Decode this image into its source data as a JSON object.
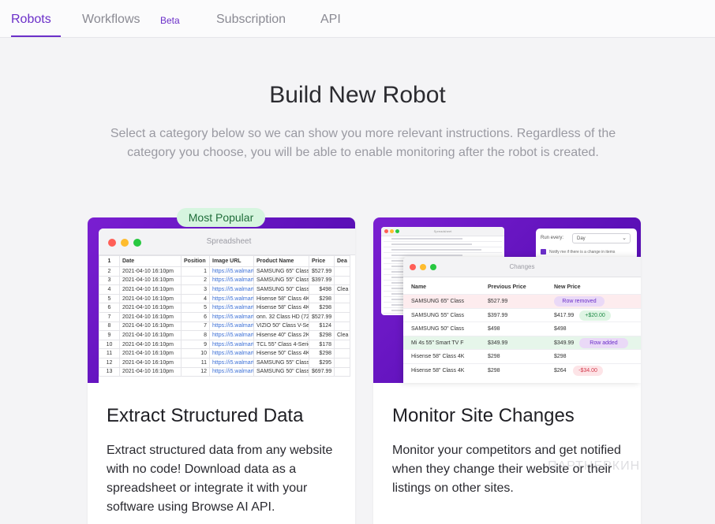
{
  "nav": {
    "tabs": [
      {
        "label": "Robots"
      },
      {
        "label": "Workflows"
      },
      {
        "label": "Subscription"
      },
      {
        "label": "API"
      }
    ],
    "beta_badge": "Beta"
  },
  "header": {
    "title": "Build New Robot",
    "subtitle": "Select a category below so we can show you more relevant instructions. Regardless of the category you choose, you will be able to enable monitoring after the robot is created."
  },
  "badge": "Most Popular",
  "cards": [
    {
      "title": "Extract Structured Data",
      "description": "Extract structured data from any website with no code! Download data as a spreadsheet or integrate it with your software using Browse AI API."
    },
    {
      "title": "Monitor Site Changes",
      "description": "Monitor your competitors and get notified when they change their website or their listings on other sites."
    }
  ],
  "spreadsheet": {
    "window_title": "Spreadsheet",
    "headers": [
      "1",
      "Date",
      "Position",
      "Image URL",
      "Product Name",
      "Price",
      "Dea"
    ],
    "rows": [
      [
        "2",
        "2021-04-10 16:10pm",
        "1",
        "https://i5.walmarti",
        "SAMSUNG 65\" Class",
        "$527.99",
        ""
      ],
      [
        "3",
        "2021-04-10 16:10pm",
        "2",
        "https://i5.walmarti",
        "SAMSUNG 55\" Class",
        "$397.99",
        ""
      ],
      [
        "4",
        "2021-04-10 16:10pm",
        "3",
        "https://i5.walmarti",
        "SAMSUNG 50\" Class",
        "$498",
        "Clea"
      ],
      [
        "5",
        "2021-04-10 16:10pm",
        "4",
        "https://i5.walmarti",
        "Hisense 58\" Class 4K",
        "$298",
        ""
      ],
      [
        "6",
        "2021-04-10 16:10pm",
        "5",
        "https://i5.walmarti",
        "Hisense 58\" Class 4K",
        "$298",
        ""
      ],
      [
        "7",
        "2021-04-10 16:10pm",
        "6",
        "https://i5.walmarti",
        "onn. 32 Class HD (72",
        "$527.99",
        ""
      ],
      [
        "8",
        "2021-04-10 16:10pm",
        "7",
        "https://i5.walmarti",
        "VIZIO 50\" Class V-Ser",
        "$124",
        ""
      ],
      [
        "9",
        "2021-04-10 16:10pm",
        "8",
        "https://i5.walmarti",
        "Hisense 40\" Class 2K",
        "$298",
        "Clea"
      ],
      [
        "10",
        "2021-04-10 16:10pm",
        "9",
        "https://i5.walmarti",
        "TCL 55\" Class 4-Serie",
        "$178",
        ""
      ],
      [
        "11",
        "2021-04-10 16:10pm",
        "10",
        "https://i5.walmarti",
        "Hisense 50\" Class 4K",
        "$298",
        ""
      ],
      [
        "12",
        "2021-04-10 16:10pm",
        "11",
        "https://i5.walmarti",
        "SAMSUNG 55\" Class",
        "$295",
        ""
      ],
      [
        "13",
        "2021-04-10 16:10pm",
        "12",
        "https://i5.walmarti",
        "SAMSUNG 50\" Class",
        "$697.99",
        ""
      ]
    ]
  },
  "monitor": {
    "small_window_title": "Spreadsheet",
    "run_every_label": "Run every:",
    "run_every_value": "Day",
    "notify_label": "Notify me if there is a change in items",
    "window_title": "Changes",
    "headers": [
      "Name",
      "Previous Price",
      "New Price"
    ],
    "rows": [
      {
        "name": "SAMSUNG 65\" Class",
        "prev": "$527.99",
        "new": "",
        "tag": "Row removed",
        "status": "removed"
      },
      {
        "name": "SAMSUNG 55\" Class",
        "prev": "$397.99",
        "new": "$417.99",
        "tag": "+$20.00",
        "status": "up"
      },
      {
        "name": "SAMSUNG 50\" Class",
        "prev": "$498",
        "new": "$498",
        "tag": "",
        "status": "none"
      },
      {
        "name": "Mi 4s 55\" Smart TV F",
        "prev": "$349.99",
        "new": "$349.99",
        "tag": "Row added",
        "status": "added"
      },
      {
        "name": "Hisense 58\" Class 4K",
        "prev": "$298",
        "new": "$298",
        "tag": "",
        "status": "none"
      },
      {
        "name": "Hisense 58\" Class 4K",
        "prev": "$298",
        "new": "$264",
        "tag": "-$34.00",
        "status": "down"
      }
    ]
  },
  "watermark": "ПАРТНЕРКИН",
  "colors": {
    "accent": "#6b2fc9",
    "card_gradient_start": "#7a1fd1",
    "popular_bg": "#d6f5df",
    "removed_bg": "#fdecee",
    "added_bg": "#e6f6ea"
  }
}
